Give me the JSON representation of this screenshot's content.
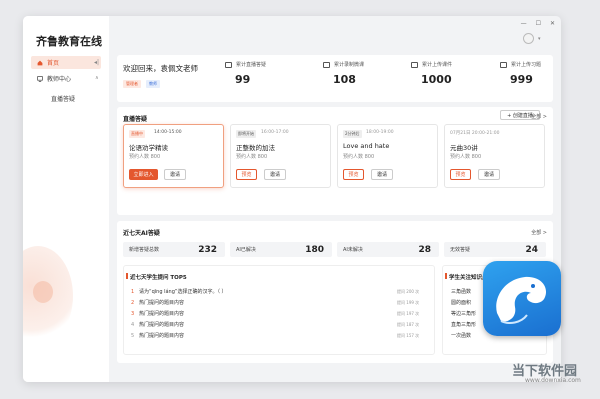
{
  "app": {
    "title": "齐鲁教育在线"
  },
  "sidebar": {
    "items": [
      {
        "label": "首页",
        "active": true
      },
      {
        "label": "教师中心",
        "active": false
      },
      {
        "label": "直播答疑",
        "active": false
      }
    ]
  },
  "welcome": {
    "greeting": "欢迎回来，袁佩文老师",
    "tags": [
      "管理者",
      "教师"
    ],
    "stats": [
      {
        "label": "累计直播答疑",
        "value": "99"
      },
      {
        "label": "累计录制微课",
        "value": "108"
      },
      {
        "label": "累计上传课件",
        "value": "1000"
      },
      {
        "label": "累计上传习题",
        "value": "999"
      }
    ]
  },
  "live": {
    "title": "直播答疑",
    "create_label": "+ 创建直播",
    "more_label": "全部 >",
    "cards": [
      {
        "status": "直播中",
        "time": "14:00-15:00",
        "name": "论语劝学精读",
        "appt": "预约人数 800",
        "primary": "立即进入",
        "invite": "邀请"
      },
      {
        "status": "即将开始",
        "time": "16:00-17:00",
        "name": "正整数的加法",
        "appt": "预约人数 800",
        "primary": "预览",
        "invite": "邀请"
      },
      {
        "status": "2分钟后",
        "time": "18:00-19:00",
        "name": "Love and hate",
        "appt": "预约人数 800",
        "primary": "预览",
        "invite": "邀请"
      },
      {
        "status": "",
        "time": "07月21日 20:00-21:00",
        "name": "元曲30讲",
        "appt": "预约人数 800",
        "primary": "预览",
        "invite": "邀请"
      }
    ]
  },
  "ai": {
    "title": "近七天AI答疑",
    "more_label": "全部 >",
    "stats": [
      {
        "label": "新增答疑总数",
        "value": "232"
      },
      {
        "label": "AI已解决",
        "value": "180"
      },
      {
        "label": "AI未解决",
        "value": "28"
      },
      {
        "label": "无效答疑",
        "value": "24"
      }
    ],
    "top5": {
      "title": "近七天学生提问 TOP5",
      "items": [
        {
          "rank": "1",
          "text": "请为“qīng láng”选择正确的汉字。（ ）",
          "count": "提问 200 次"
        },
        {
          "rank": "2",
          "text": "热门提问的题目内容",
          "count": "提问 199 次"
        },
        {
          "rank": "3",
          "text": "热门提问的题目内容",
          "count": "提问 197 次"
        },
        {
          "rank": "4",
          "text": "热门提问的题目内容",
          "count": "提问 187 次"
        },
        {
          "rank": "5",
          "text": "热门提问的题目内容",
          "count": "提问 157 次"
        }
      ]
    },
    "knowledge": {
      "title": "学生关注知识点",
      "items": [
        "三角函数",
        "圆的面积",
        "等边三角形",
        "直角三角形",
        "一次函数"
      ]
    }
  },
  "watermark": {
    "text": "当下软件园",
    "url": "www.downxia.com"
  },
  "colors": {
    "accent": "#e4572e",
    "brand_blue": "#1f86e0"
  }
}
